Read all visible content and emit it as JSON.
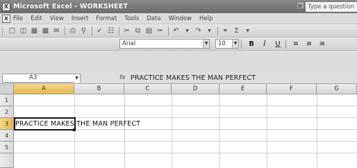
{
  "window": {
    "title": "Microsoft Excel - WORKSHEET",
    "app_icon": "excel-icon",
    "help_placeholder": "Type a question"
  },
  "menu": {
    "items": [
      "File",
      "Edit",
      "View",
      "Insert",
      "Format",
      "Tools",
      "Data",
      "Window",
      "Help"
    ]
  },
  "toolbar_standard": {
    "icons": [
      "new-icon",
      "open-icon",
      "save-icon",
      "permission-icon",
      "email-icon",
      "print-icon",
      "print-preview-icon",
      "spelling-icon",
      "research-icon",
      "cut-icon",
      "copy-icon",
      "paste-icon",
      "format-painter-icon",
      "undo-icon",
      "redo-icon",
      "hyperlink-icon",
      "autosum-icon"
    ]
  },
  "toolbar_formatting": {
    "font_name": "Arial",
    "font_size": "10",
    "bold": "B",
    "italic": "I",
    "underline": "U"
  },
  "formula_bar": {
    "name_box": "A3",
    "fx": "fx",
    "content": "PRACTICE MAKES THE MAN PERFECT"
  },
  "grid": {
    "columns": [
      "A",
      "B",
      "C",
      "D",
      "E",
      "F",
      "G"
    ],
    "rows": [
      "1",
      "2",
      "3",
      "4",
      "5"
    ],
    "active_cell": "A3",
    "cells": {
      "A3": "PRACTICE MAKES THE MAN PERFECT"
    }
  }
}
